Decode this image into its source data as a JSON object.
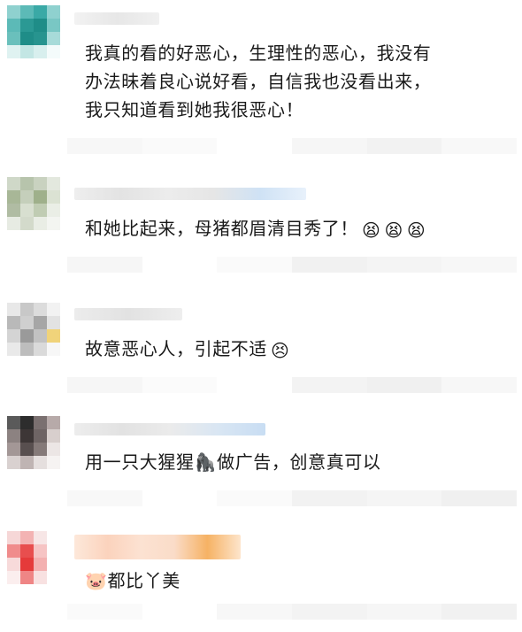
{
  "comments": [
    {
      "avatar_colors": [
        "#8fd1cf",
        "#5cbab7",
        "#3aa9a6",
        "#8fd1cf",
        "#5cbab7",
        "#2b9994",
        "#1f8d88",
        "#79c7c4",
        "#6ac0bc",
        "#1f8d88",
        "#27948f",
        "#a7dbd9",
        "#dff2f1",
        "#c3e6e4",
        "#d8efee",
        "#f4fbfb"
      ],
      "lines": [
        "我真的看的好恶心，生理性的恶心，我没有",
        "办法昧着良心说好看，自信我也没看出来，",
        "我只知道看到她我很恶心！"
      ],
      "emojis": []
    },
    {
      "avatar_colors": [
        "#cfd8c8",
        "#b7c4ac",
        "#c9d2c0",
        "#e3e8de",
        "#a8b797",
        "#c5cfbb",
        "#9fb08b",
        "#dbe2d3",
        "#b0bca3",
        "#d8dfd0",
        "#c0ccb3",
        "#eaeee6",
        "#e7ebe3",
        "#d3dacb",
        "#e9ede5",
        "#f3f5f1"
      ],
      "lines": [
        "和她比起来，母猪都眉清目秀了！"
      ],
      "emojis": [
        "😫",
        "😫",
        "😫"
      ]
    },
    {
      "avatar_colors": [
        "#e8e8e8",
        "#c8c8c8",
        "#dcdcdc",
        "#f2f2f2",
        "#b9b9b9",
        "#cfcfcf",
        "#a6a6a6",
        "#e2e2e2",
        "#d4d4d4",
        "#9a9a9a",
        "#c2c2c2",
        "#f0d37a",
        "#e9e9e9",
        "#bdbdbd",
        "#dadada",
        "#f7f7f7"
      ],
      "lines": [
        "故意恶心人，引起不适"
      ],
      "emojis": [
        "😣"
      ]
    },
    {
      "avatar_colors": [
        "#5a5a5a",
        "#2d2d2d",
        "#7a7070",
        "#b7aaa9",
        "#8c8281",
        "#3d3636",
        "#6e6464",
        "#d8cfcd",
        "#a39796",
        "#584f4f",
        "#857a79",
        "#ece6e5",
        "#d9d1d0",
        "#bfb4b3",
        "#e5dfde",
        "#f6f3f2"
      ],
      "lines": [
        "用一只大猩猩🦍做广告，创意真可以"
      ],
      "emojis": []
    },
    {
      "avatar_colors": [
        "#f6d7d7",
        "#f3b3b3",
        "#f7e6e6",
        "#ffffff",
        "#f08c8c",
        "#e84e4e",
        "#f6c4c4",
        "#ffffff",
        "#f7dada",
        "#e53a3a",
        "#f3b0b0",
        "#ffffff",
        "#fbeeee",
        "#ef8585",
        "#f8e1e1",
        "#ffffff"
      ],
      "lines": [
        "🐷都比丫美"
      ],
      "emojis": []
    }
  ]
}
